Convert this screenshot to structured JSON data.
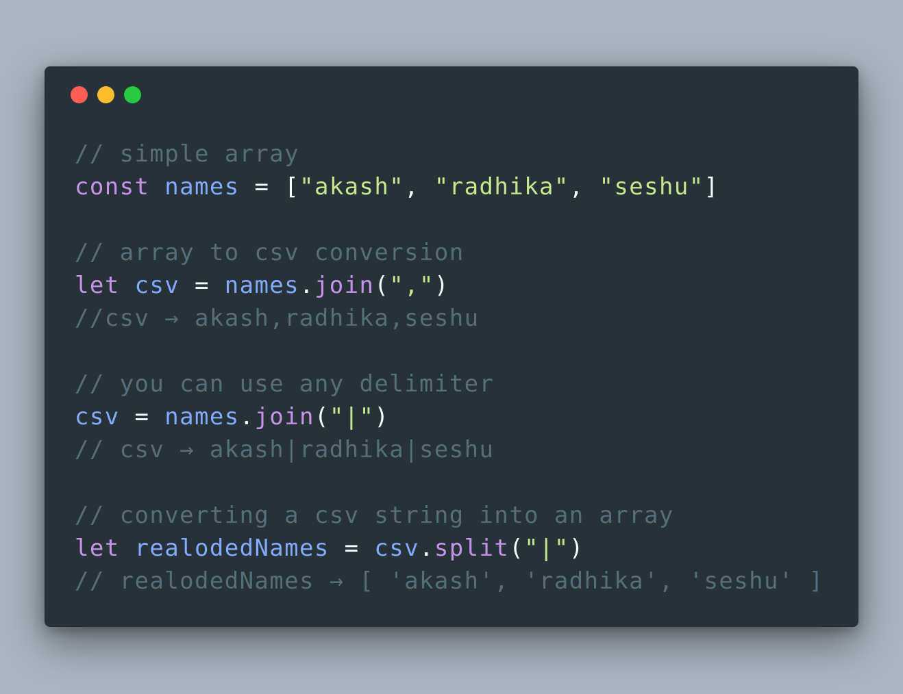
{
  "colors": {
    "background": "#a9b4bf",
    "window": "#263238",
    "close": "#ff5f56",
    "minimize": "#ffbd2e",
    "zoom": "#27c93f",
    "comment": "#546e7a",
    "keyword": "#c792ea",
    "variable": "#82aaff",
    "string": "#c3e88d",
    "plain": "#eeffff"
  },
  "titlebar": {
    "close_icon": "close-dot-icon",
    "minimize_icon": "minimize-dot-icon",
    "zoom_icon": "zoom-dot-icon"
  },
  "code": {
    "line1": {
      "comment": "// simple array"
    },
    "line2": {
      "kw": "const",
      "name": "names",
      "eq": " = ",
      "open": "[",
      "s1": "\"akash\"",
      "sep1": ", ",
      "s2": "\"radhika\"",
      "sep2": ", ",
      "s3": "\"seshu\"",
      "close": "]"
    },
    "line3": {
      "comment": "// array to csv conversion"
    },
    "line4": {
      "kw": "let",
      "name": "csv",
      "eq": " = ",
      "obj": "names",
      "dot": ".",
      "fn": "join",
      "open": "(",
      "arg": "\",\"",
      "close": ")"
    },
    "line5": {
      "comment": "//csv → akash,radhika,seshu"
    },
    "line6": {
      "comment": "// you can use any delimiter"
    },
    "line7": {
      "name": "csv",
      "eq": " = ",
      "obj": "names",
      "dot": ".",
      "fn": "join",
      "open": "(",
      "arg": "\"|\"",
      "close": ")"
    },
    "line8": {
      "comment": "// csv → akash|radhika|seshu"
    },
    "line9": {
      "comment": "// converting a csv string into an array"
    },
    "line10": {
      "kw": "let",
      "name": "realodedNames",
      "eq": " = ",
      "obj": "csv",
      "dot": ".",
      "fn": "split",
      "open": "(",
      "arg": "\"|\"",
      "close": ")"
    },
    "line11": {
      "comment": "// realodedNames → [ 'akash', 'radhika', 'seshu' ]"
    }
  }
}
